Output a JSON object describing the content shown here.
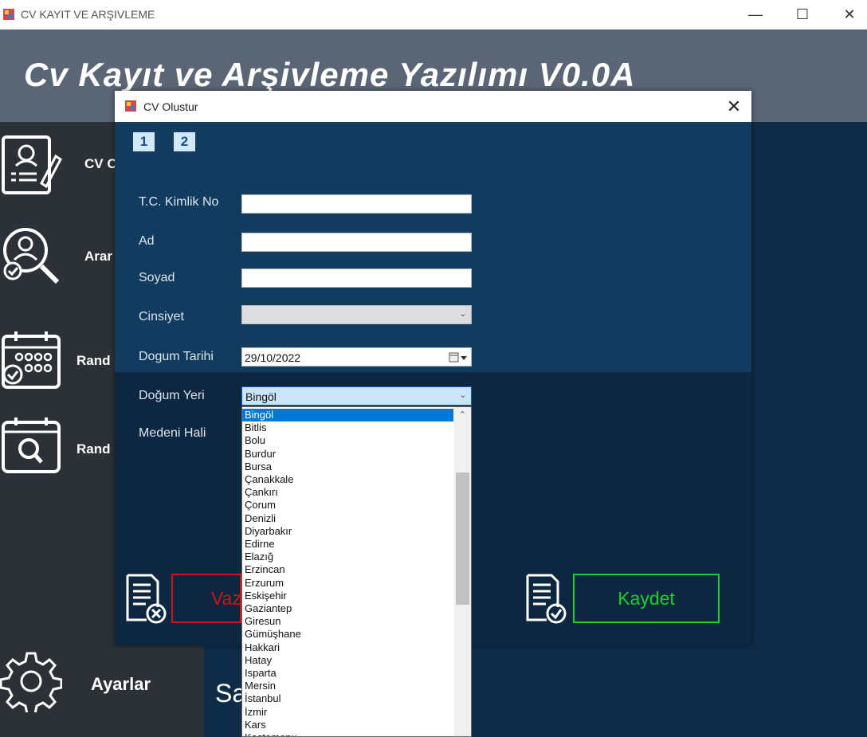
{
  "main_window": {
    "title": "CV KAYIT VE ARŞIVLEME"
  },
  "banner": {
    "title": "Cv Kayıt ve Arşivleme Yazılımı V0.0A"
  },
  "sidebar": {
    "items": [
      {
        "label": "CV O",
        "icon": "resume-edit-icon"
      },
      {
        "label": "Arar",
        "icon": "user-search-icon"
      },
      {
        "label": "Rand",
        "icon": "calendar-check-icon"
      },
      {
        "label": "Rand",
        "icon": "calendar-search-icon"
      },
      {
        "label": "Ayarlar",
        "icon": "gear-icon"
      }
    ]
  },
  "content": {
    "partial_text": "Sa"
  },
  "dialog": {
    "title": "CV Olustur",
    "pages": [
      "1",
      "2"
    ],
    "fields": {
      "tc_label": "T.C. Kimlik No",
      "tc_value": "",
      "ad_label": "Ad",
      "ad_value": "",
      "soyad_label": "Soyad",
      "soyad_value": "",
      "cinsiyet_label": "Cinsiyet",
      "cinsiyet_value": "",
      "dogum_tarihi_label": "Dogum Tarihi",
      "dogum_tarihi_value": "29/10/2022",
      "dogum_yeri_label": "Doğum Yeri",
      "dogum_yeri_value": "Bingöl",
      "medeni_hali_label": "Medeni Hali"
    },
    "buttons": {
      "delete_label": "Vaz",
      "save_label": "Kaydet"
    }
  },
  "dropdown": {
    "items": [
      "Bingöl",
      "Bitlis",
      "Bolu",
      "Burdur",
      "Bursa",
      "Çanakkale",
      "Çankırı",
      "Çorum",
      "Denizli",
      "Diyarbakır",
      "Edirne",
      "Elazığ",
      "Erzincan",
      "Erzurum",
      "Eskişehir",
      "Gaziantep",
      "Giresun",
      "Gümüşhane",
      "Hakkari",
      "Hatay",
      "Isparta",
      "Mersin",
      "İstanbul",
      "İzmir",
      "Kars",
      "Kastamonu"
    ],
    "selected_index": 0
  },
  "colors": {
    "dialog_upper": "#113b5f",
    "dialog_lower": "#0d2740",
    "sidebar": "#2b3136",
    "banner": "#5a6575",
    "save_green": "#16d12a",
    "delete_red": "#d11313",
    "selection_blue": "#0078d7"
  }
}
